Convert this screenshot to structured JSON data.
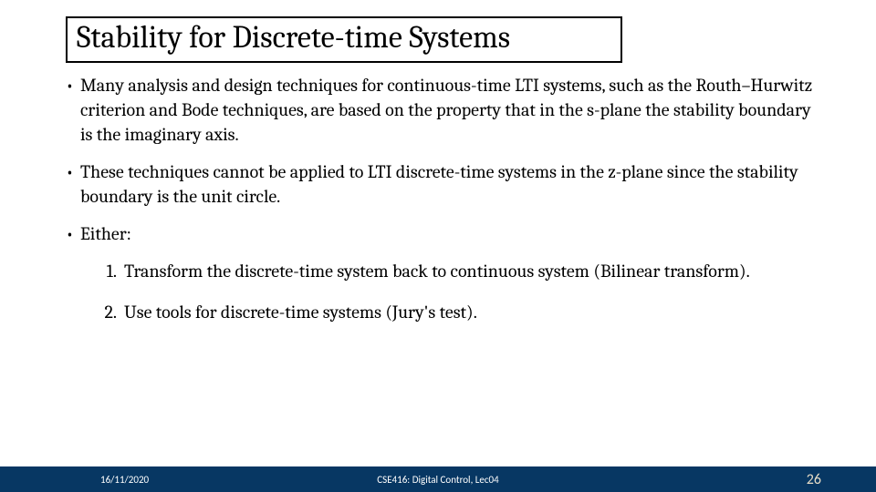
{
  "title": "Stability for Discrete-time Systems",
  "bullets": {
    "b1": "Many analysis and design techniques for continuous-time LTI systems, such as the Routh–Hurwitz criterion and Bode techniques, are based on the property that in the s-plane the stability boundary is the imaginary axis.",
    "b2": "These techniques cannot be applied to LTI discrete-time systems in the z-plane since the stability boundary is the unit circle.",
    "b3": "Either:"
  },
  "numbered": {
    "n1_num": "1.",
    "n1_txt": "Transform the discrete-time system back to continuous system (Bilinear transform).",
    "n2_num": "2.",
    "n2_txt": "Use tools for discrete-time systems (Jury's test)."
  },
  "footer": {
    "date": "16/11/2020",
    "course": "CSE416: Digital Control, Lec04",
    "page": "26"
  }
}
